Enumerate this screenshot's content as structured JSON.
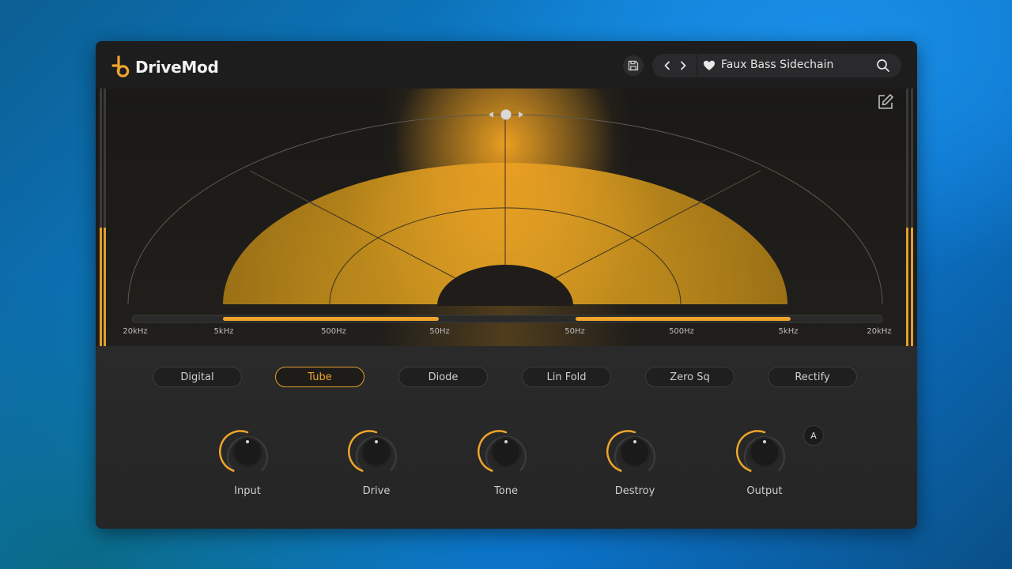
{
  "app": {
    "name": "DriveMod"
  },
  "preset": {
    "name": "Faux Bass Sidechain"
  },
  "display": {
    "freq_labels": [
      "20kHz",
      "5kHz",
      "500Hz",
      "50Hz",
      "50Hz",
      "500Hz",
      "5kHz",
      "20kHz"
    ],
    "accent_color": "#e2a02a"
  },
  "modes": [
    {
      "label": "Digital",
      "active": false
    },
    {
      "label": "Tube",
      "active": true
    },
    {
      "label": "Diode",
      "active": false
    },
    {
      "label": "Lin Fold",
      "active": false
    },
    {
      "label": "Zero Sq",
      "active": false
    },
    {
      "label": "Rectify",
      "active": false
    }
  ],
  "knobs": [
    {
      "label": "Input"
    },
    {
      "label": "Drive"
    },
    {
      "label": "Tone"
    },
    {
      "label": "Destroy"
    },
    {
      "label": "Output"
    }
  ],
  "auto_button": {
    "label": "A"
  }
}
